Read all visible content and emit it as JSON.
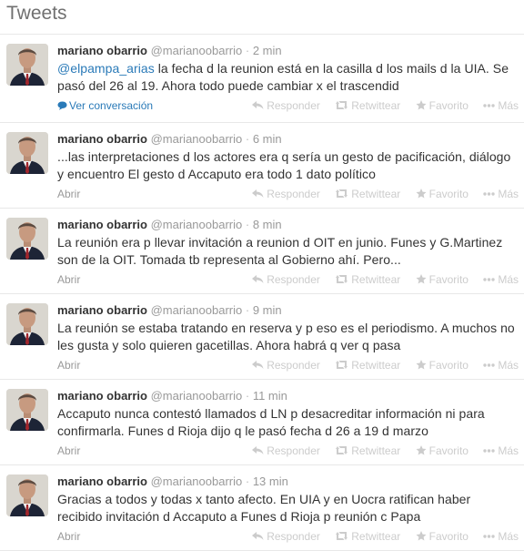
{
  "header": {
    "title": "Tweets"
  },
  "colors": {
    "link": "#2a7ab8",
    "muted": "#999999",
    "action": "#cccccc"
  },
  "actions": {
    "reply": "Responder",
    "retweet": "Retwittear",
    "favorite": "Favorito",
    "more": "Más"
  },
  "tweets": [
    {
      "name": "mariano obarrio",
      "handle": "@marianoobarrio",
      "time": "2 min",
      "mention": "@elpampa_arias",
      "text": " la fecha d la reunion está en la casilla d los mails d la UIA. Se pasó del 26 al 19. Ahora todo puede cambiar x el trascendid",
      "footer_link": "Ver conversación"
    },
    {
      "name": "mariano obarrio",
      "handle": "@marianoobarrio",
      "time": "6 min",
      "text": "...las interpretaciones d los actores era q sería un gesto de pacificación, diálogo y encuentro El gesto d Accaputo era todo 1 dato político",
      "footer_link": "Abrir"
    },
    {
      "name": "mariano obarrio",
      "handle": "@marianoobarrio",
      "time": "8 min",
      "text": "La reunión era p llevar invitación a reunion d OIT en junio. Funes y G.Martinez son de la OIT. Tomada tb representa al Gobierno ahí. Pero...",
      "footer_link": "Abrir"
    },
    {
      "name": "mariano obarrio",
      "handle": "@marianoobarrio",
      "time": "9 min",
      "text": "La reunión se estaba tratando en reserva y p eso es el periodismo. A muchos no les gusta y solo quieren gacetillas. Ahora habrá q ver q pasa",
      "footer_link": "Abrir"
    },
    {
      "name": "mariano obarrio",
      "handle": "@marianoobarrio",
      "time": "11 min",
      "text": "Accaputo nunca contestó llamados d LN p desacreditar información ni para confirmarla. Funes d Rioja dijo q le pasó fecha d 26 a 19 d marzo",
      "footer_link": "Abrir"
    },
    {
      "name": "mariano obarrio",
      "handle": "@marianoobarrio",
      "time": "13 min",
      "text": "Gracias a todos y todas x tanto afecto. En UIA y en Uocra ratifican haber recibido invitación d Accaputo a Funes d Rioja p reunión c Papa",
      "footer_link": "Abrir"
    }
  ]
}
